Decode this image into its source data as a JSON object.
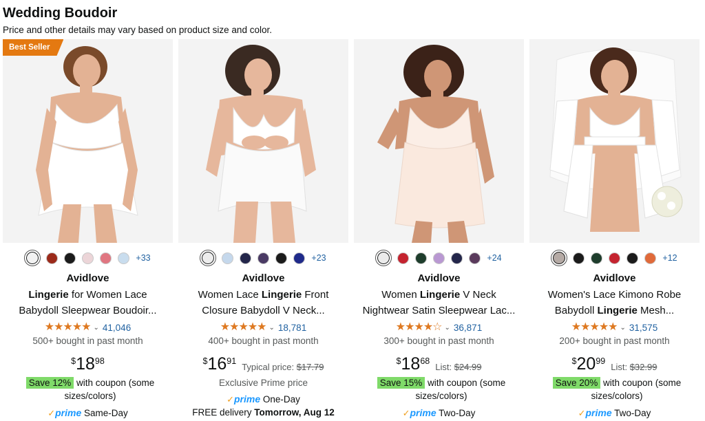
{
  "header": {
    "title": "Wedding Boudoir",
    "subtitle": "Price and other details may vary based on product size and color."
  },
  "products": [
    {
      "badge": "Best Seller",
      "brand": "Avidlove",
      "title_parts": [
        "",
        "Lingerie",
        " for Women Lace Babydoll Sleepwear Boudoir..."
      ],
      "swatch_colors": [
        "#f2f2f2",
        "#9b2a1a",
        "#1b1b1b",
        "#ecd5d8",
        "#e07681",
        "#c9ddee"
      ],
      "more_colors": "+33",
      "stars": "★★★★★",
      "rating_value": 4.5,
      "review_count": "41,046",
      "bought": "500+ bought in past month",
      "price": {
        "currency": "$",
        "whole": "18",
        "fraction": "98"
      },
      "save": "Save 12%",
      "coupon_text": " with coupon (some sizes/colors)",
      "prime_check": "✓",
      "prime_label": "prime",
      "prime_delivery": "Same-Day"
    },
    {
      "brand": "Avidlove",
      "title_parts": [
        "Women Lace ",
        "Lingerie",
        " Front Closure Babydoll V Neck..."
      ],
      "swatch_colors": [
        "#ededed",
        "#c5d8ec",
        "#23264a",
        "#4a3a64",
        "#1b1b1b",
        "#1f2a8a"
      ],
      "more_colors": "+23",
      "stars": "★★★★★",
      "rating_value": 4.5,
      "review_count": "18,781",
      "bought": "400+ bought in past month",
      "price": {
        "currency": "$",
        "whole": "16",
        "fraction": "91"
      },
      "typical_label": "Typical price: ",
      "typical_price": "$17.79",
      "exclusive": "Exclusive Prime price",
      "prime_check": "✓",
      "prime_label": "prime",
      "prime_delivery": "One-Day",
      "delivery_prefix": "FREE delivery ",
      "delivery_date": "Tomorrow, Aug 12"
    },
    {
      "brand": "Avidlove",
      "title_parts": [
        "Women ",
        "Lingerie",
        " V Neck Nightwear Satin Sleepwear Lac..."
      ],
      "swatch_colors": [
        "#ebebeb",
        "#c4232f",
        "#1e3d2c",
        "#b998d2",
        "#23264a",
        "#5a3a5c"
      ],
      "more_colors": "+24",
      "stars": "★★★★☆",
      "rating_value": 4.0,
      "review_count": "36,871",
      "bought": "300+ bought in past month",
      "price": {
        "currency": "$",
        "whole": "18",
        "fraction": "68"
      },
      "list_label": "List: ",
      "list_price": "$24.99",
      "save": "Save 15%",
      "coupon_text": " with coupon (some sizes/colors)",
      "prime_check": "✓",
      "prime_label": "prime",
      "prime_delivery": "Two-Day"
    },
    {
      "brand": "Avidlove",
      "title_parts": [
        "Women's Lace Kimono Robe Babydoll ",
        "Lingerie",
        " Mesh..."
      ],
      "swatch_colors": [
        "#b5aaa5",
        "#1b1b1b",
        "#1e3d2c",
        "#c4232f",
        "#1b1b1b",
        "#e06a3a"
      ],
      "more_colors": "+12",
      "stars": "★★★★★",
      "rating_value": 4.5,
      "review_count": "31,575",
      "bought": "200+ bought in past month",
      "price": {
        "currency": "$",
        "whole": "20",
        "fraction": "99"
      },
      "list_label": "List: ",
      "list_price": "$32.99",
      "save": "Save 20%",
      "coupon_text": " with coupon (some sizes/colors)",
      "prime_check": "✓",
      "prime_label": "prime",
      "prime_delivery": "Two-Day"
    }
  ]
}
